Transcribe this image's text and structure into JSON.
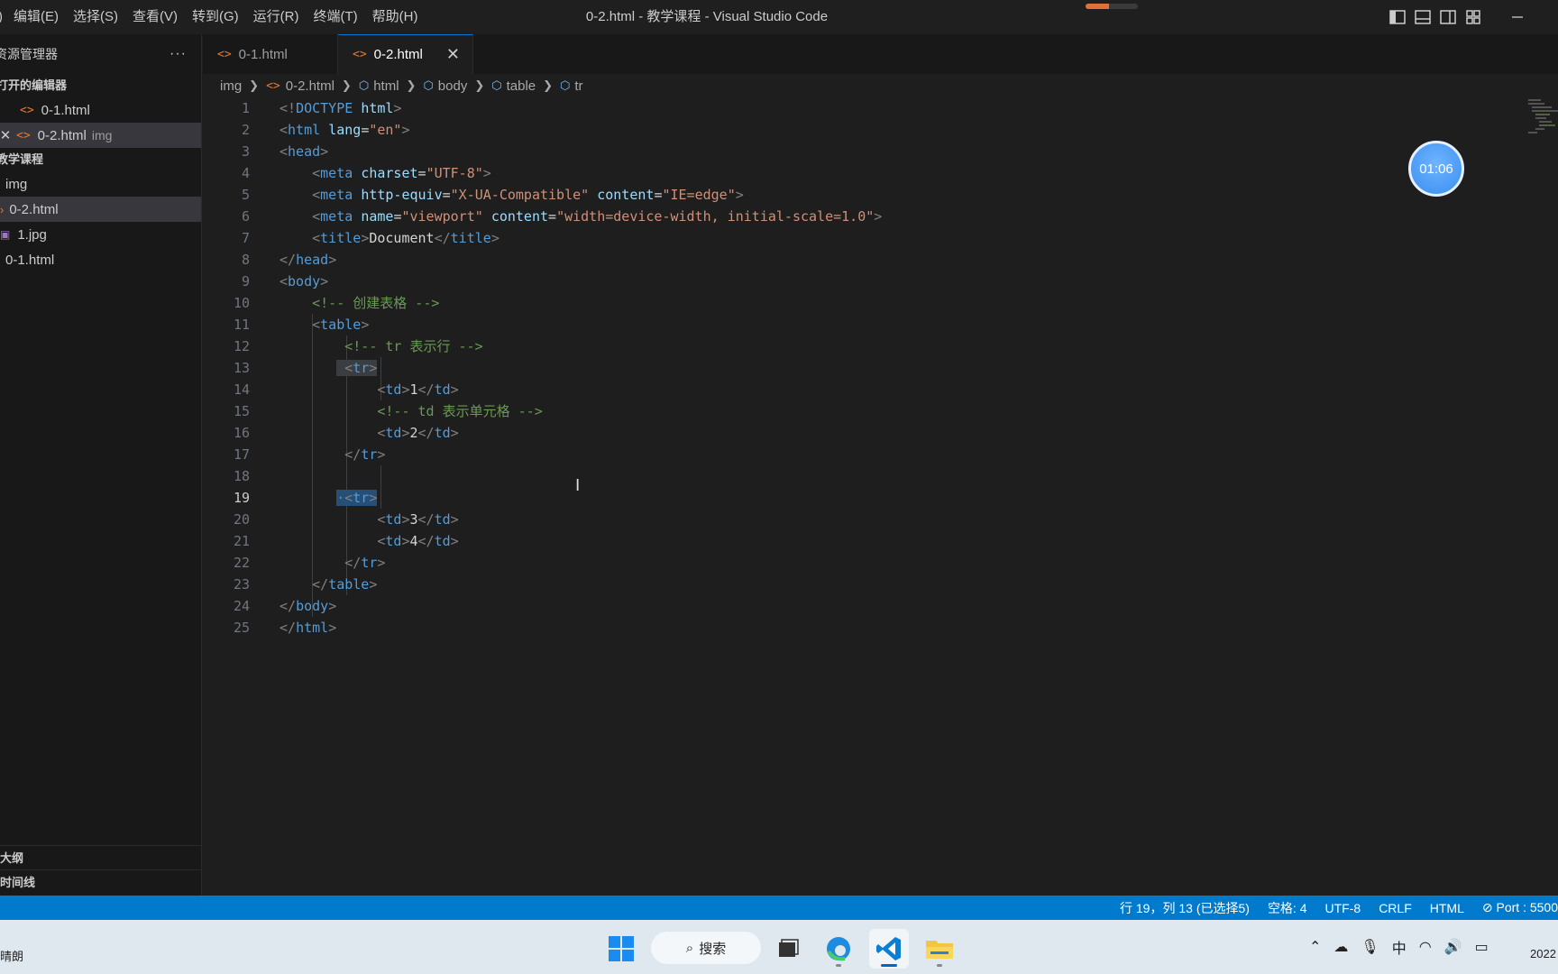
{
  "window_title": "0-2.html - 教学课程 - Visual Studio Code",
  "menu": [
    "编辑(E)",
    "选择(S)",
    "查看(V)",
    "转到(G)",
    "运行(R)",
    "终端(T)",
    "帮助(H)"
  ],
  "menu_fragment": ")",
  "sidebar": {
    "title": "资源管理器",
    "more": "···",
    "open_editors_title": "打开的编辑器",
    "open_editors": [
      {
        "name": "0-1.html",
        "desc": ""
      },
      {
        "name": "0-2.html",
        "desc": "img",
        "close": "✕"
      }
    ],
    "project_title": "教学课程",
    "tree": [
      "img",
      "0-2.html",
      "1.jpg",
      "0-1.html"
    ],
    "outline": "大纲",
    "timeline": "时间线"
  },
  "tabs": [
    {
      "label": "0-1.html",
      "active": false
    },
    {
      "label": "0-2.html",
      "active": true,
      "close": "✕"
    }
  ],
  "breadcrumb": [
    "img",
    "0-2.html",
    "html",
    "body",
    "table",
    "tr"
  ],
  "editor": {
    "current_line": 19,
    "cursor_line_text": "行 19, 列 13"
  },
  "timer": "01:06",
  "status": {
    "position": "行 19，列 13 (已选择5)",
    "spaces": "空格: 4",
    "encoding": "UTF-8",
    "eol": "CRLF",
    "language": "HTML",
    "port": "Port : 5500"
  },
  "taskbar": {
    "weather": "晴朗",
    "search": "搜索",
    "ime": "中",
    "clock": "2022"
  },
  "colors": {
    "accent": "#007acc",
    "tag": "#569cd6",
    "attr": "#9cdcfe",
    "string": "#ce9178",
    "comment": "#6a9955"
  }
}
